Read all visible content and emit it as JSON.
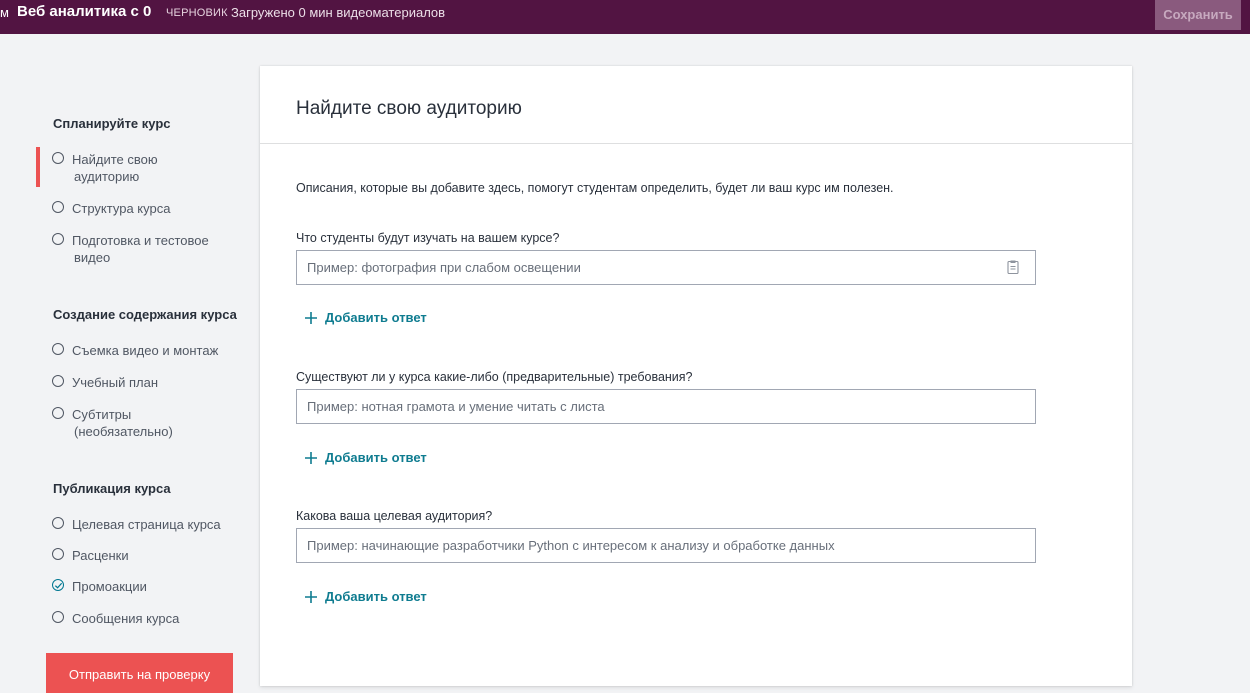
{
  "topbar": {
    "back_glyph": "м",
    "course_title": "Веб аналитика с 0",
    "status_badge": "ЧЕРНОВИК",
    "upload_status": "Загружено 0 мин видеоматериалов",
    "save_label": "Сохранить"
  },
  "sidebar": {
    "sections": [
      {
        "heading": "Спланируйте курс",
        "items": [
          {
            "line1": "Найдите свою",
            "line2": "аудиторию",
            "active": true,
            "checked": false
          },
          {
            "line1": "Структура курса",
            "line2": "",
            "active": false,
            "checked": false
          },
          {
            "line1": "Подготовка и тестовое",
            "line2": "видео",
            "active": false,
            "checked": false
          }
        ]
      },
      {
        "heading": "Создание содержания курса",
        "items": [
          {
            "line1": "Съемка видео и монтаж",
            "line2": "",
            "active": false,
            "checked": false
          },
          {
            "line1": "Учебный план",
            "line2": "",
            "active": false,
            "checked": false
          },
          {
            "line1": "Субтитры",
            "line2": "(необязательно)",
            "active": false,
            "checked": false
          }
        ]
      },
      {
        "heading": "Публикация курса",
        "items": [
          {
            "line1": "Целевая страница курса",
            "line2": "",
            "active": false,
            "checked": false
          },
          {
            "line1": "Расценки",
            "line2": "",
            "active": false,
            "checked": false
          },
          {
            "line1": "Промоакции",
            "line2": "",
            "active": false,
            "checked": true
          },
          {
            "line1": "Сообщения курса",
            "line2": "",
            "active": false,
            "checked": false
          }
        ]
      }
    ],
    "submit_label": "Отправить на проверку"
  },
  "main": {
    "title": "Найдите свою аудиторию",
    "intro": "Описания, которые вы добавите здесь, помогут студентам определить, будет ли ваш курс им полезен.",
    "questions": [
      {
        "label": "Что студенты будут изучать на вашем курсе?",
        "placeholder": "Пример: фотография при слабом освещении",
        "add_label": "Добавить ответ"
      },
      {
        "label": "Существуют ли у курса какие-либо (предварительные) требования?",
        "placeholder": "Пример: нотная грамота и умение читать с листа",
        "add_label": "Добавить ответ"
      },
      {
        "label": "Какова ваша целевая аудитория?",
        "placeholder": "Пример: начинающие разработчики Python с интересом к анализу и обработке данных",
        "add_label": "Добавить ответ"
      }
    ]
  },
  "colors": {
    "topbar": "#521442",
    "accent_red": "#ec5252",
    "link_teal": "#0f7c90"
  },
  "icons": {
    "nav_status": "circle-icon",
    "nav_done": "check-circle-icon",
    "add": "plus-icon",
    "input_helper": "clipboard-icon"
  }
}
